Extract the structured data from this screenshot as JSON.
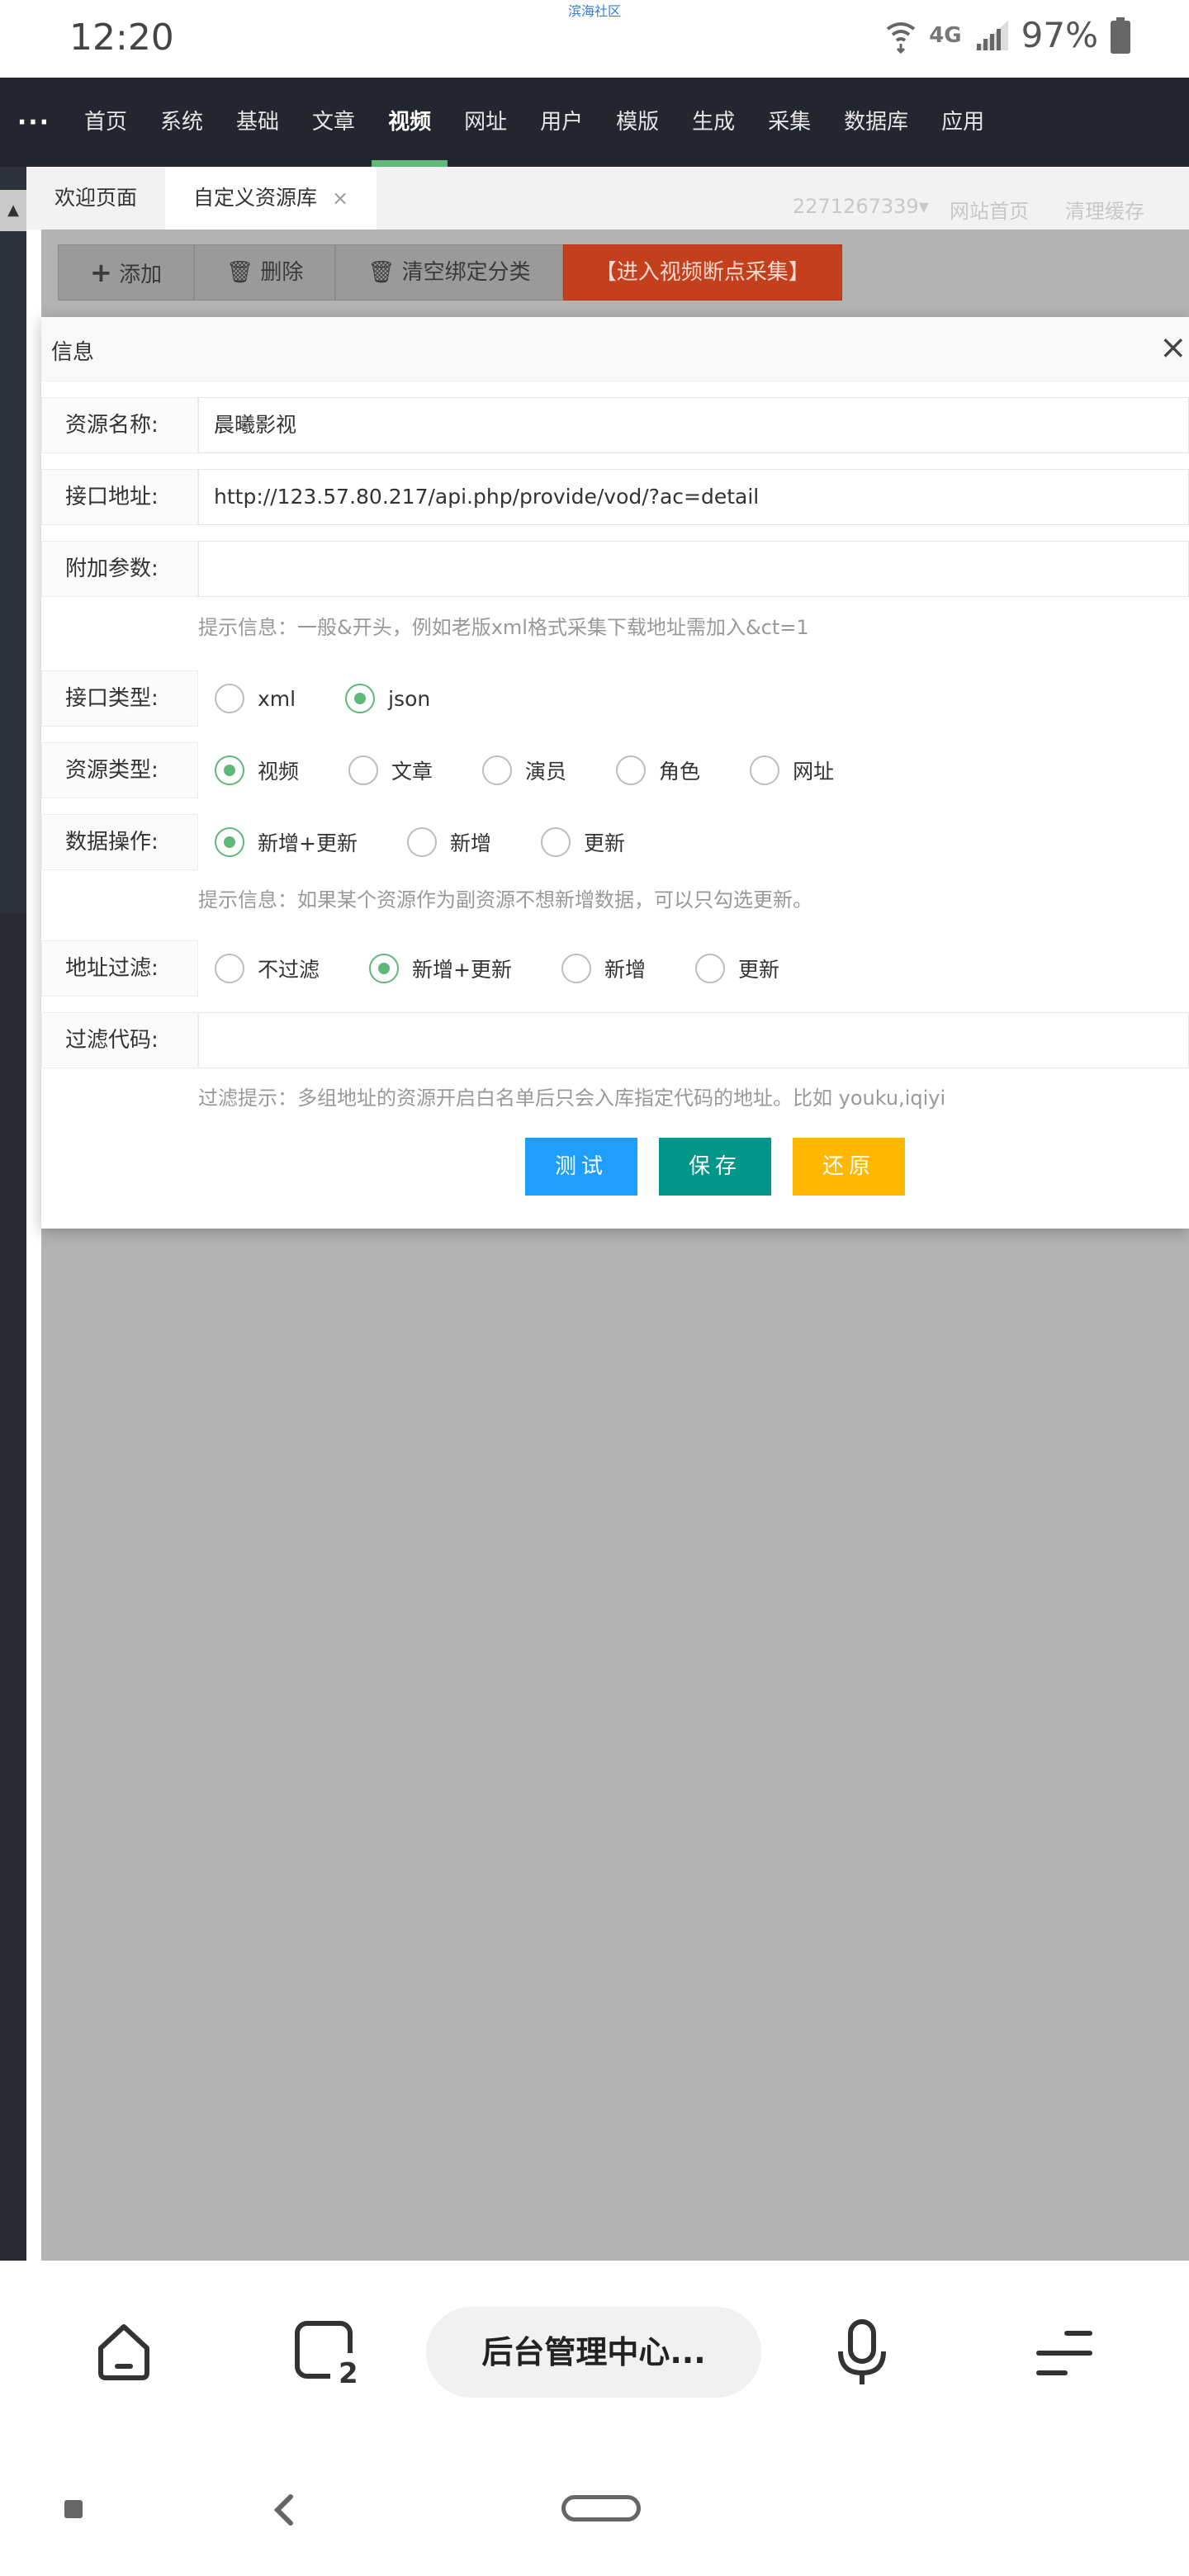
{
  "status": {
    "time": "12:20",
    "center_text": "滨海社区",
    "network": "4G",
    "battery": "97%"
  },
  "nav": {
    "more": "···",
    "items": [
      "首页",
      "系统",
      "基础",
      "文章",
      "视频",
      "网址",
      "用户",
      "模版",
      "生成",
      "采集",
      "数据库",
      "应用"
    ],
    "active": "视频"
  },
  "tabs": {
    "welcome": "欢迎页面",
    "custom": "自定义资源库",
    "close": "×"
  },
  "toolbar": {
    "add": "添加",
    "delete": "删除",
    "clear": "清空绑定分类",
    "enter": "【进入视频断点采集】"
  },
  "faded": {
    "user": "2271267339▾",
    "site": "网站首页",
    "cache": "清理缓存"
  },
  "dialog": {
    "title": "信息",
    "close": "×",
    "name_label": "资源名称:",
    "name_value": "晨曦影视",
    "api_label": "接口地址:",
    "api_value": "http://123.57.80.217/api.php/provide/vod/?ac=detail",
    "param_label": "附加参数:",
    "param_value": "",
    "param_hint": "提示信息：一般&开头，例如老版xml格式采集下载地址需加入&ct=1",
    "type_label": "接口类型:",
    "type_options": [
      "xml",
      "json"
    ],
    "type_selected": "json",
    "res_label": "资源类型:",
    "res_options": [
      "视频",
      "文章",
      "演员",
      "角色",
      "网址"
    ],
    "res_selected": "视频",
    "op_label": "数据操作:",
    "op_options": [
      "新增+更新",
      "新增",
      "更新"
    ],
    "op_selected": "新增+更新",
    "op_hint": "提示信息：如果某个资源作为副资源不想新增数据，可以只勾选更新。",
    "filter_label": "地址过滤:",
    "filter_options": [
      "不过滤",
      "新增+更新",
      "新增",
      "更新"
    ],
    "filter_selected": "新增+更新",
    "code_label": "过滤代码:",
    "code_value": "",
    "code_hint": "过滤提示：多组地址的资源开启白名单后只会入库指定代码的地址。比如 youku,iqiyi",
    "btn_test": "测试",
    "btn_save": "保存",
    "btn_reset": "还原"
  },
  "browser": {
    "address": "后台管理中心..."
  },
  "colors": {
    "nav_bg": "#23262e",
    "accent_green": "#5fb878",
    "btn_blue": "#1e9fff",
    "btn_teal": "#009688",
    "btn_orange": "#ffb800",
    "btn_red": "#c4401c"
  }
}
